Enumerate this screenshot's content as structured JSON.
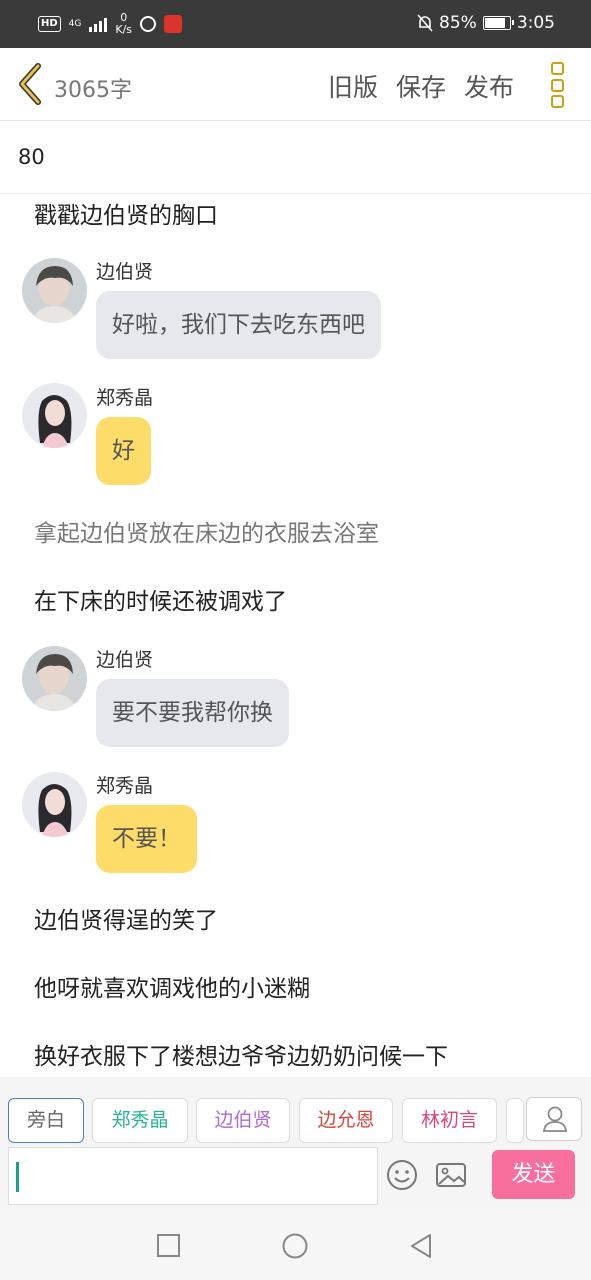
{
  "status_bar": {
    "hd": "HD",
    "network": "4G",
    "speed_value": "0",
    "speed_unit": "K/s",
    "battery": "85%",
    "time": "3:05"
  },
  "toolbar": {
    "word_count": "3065字",
    "old_version": "旧版",
    "save": "保存",
    "publish": "发布"
  },
  "chapter_title": "80",
  "messages": [
    {
      "type": "narration",
      "text": "戳戳边伯贤的胸口"
    },
    {
      "type": "dialogue",
      "speaker": "边伯贤",
      "text": "好啦，我们下去吃东西吧"
    },
    {
      "type": "dialogue",
      "speaker": "郑秀晶",
      "text": "好"
    },
    {
      "type": "narration",
      "text": "拿起边伯贤放在床边的衣服去浴室"
    },
    {
      "type": "narration",
      "text": "在下床的时候还被调戏了"
    },
    {
      "type": "dialogue",
      "speaker": "边伯贤",
      "text": "要不要我帮你换"
    },
    {
      "type": "dialogue",
      "speaker": "郑秀晶",
      "text": "不要！"
    },
    {
      "type": "narration",
      "text": "边伯贤得逞的笑了"
    },
    {
      "type": "narration",
      "text": "他呀就喜欢调戏他的小迷糊"
    },
    {
      "type": "narration",
      "text": "换好衣服下了楼想边爷爷边奶奶问候一下"
    }
  ],
  "roles": [
    {
      "label": "旁白",
      "color": "#666666"
    },
    {
      "label": "郑秀晶",
      "color": "#2bb39a"
    },
    {
      "label": "边伯贤",
      "color": "#b06ad1"
    },
    {
      "label": "边允恩",
      "color": "#d9473f"
    },
    {
      "label": "林初言",
      "color": "#d8467c"
    }
  ],
  "input": {
    "send": "发送"
  },
  "colors": {
    "accent_yellow": "#c9a214",
    "bubble_grey": "#e6e8ee",
    "bubble_yellow": "#fddc6a",
    "send_pink": "#f86e9c"
  }
}
